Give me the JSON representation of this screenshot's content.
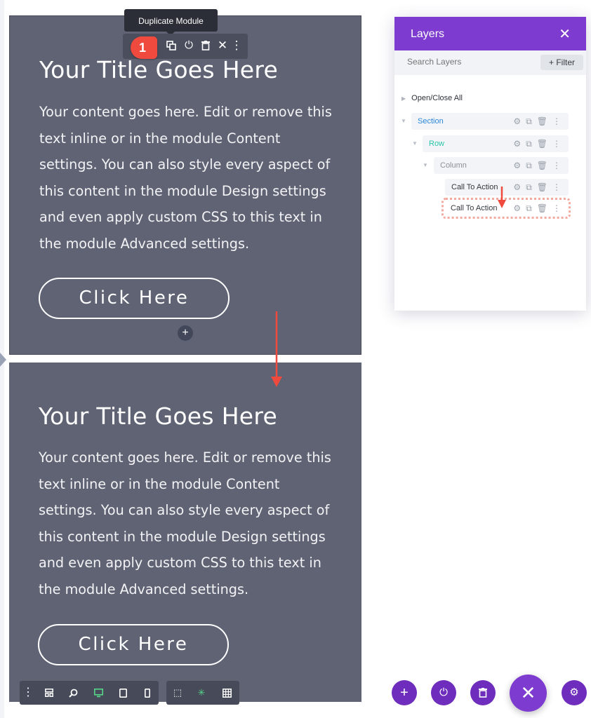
{
  "tooltip": "Duplicate Module",
  "step_badge": "1",
  "modules": [
    {
      "title": "Your Title Goes Here",
      "content": "Your content goes here. Edit or remove this text inline or in the module Content settings. You can also style every aspect of this content in the module Design settings and even apply custom CSS to this text in the module Advanced settings.",
      "button": "Click Here"
    },
    {
      "title": "Your Title Goes Here",
      "content": "Your content goes here. Edit or remove this text inline or in the module Content settings. You can also style every aspect of this content in the module Design settings and even apply custom CSS to this text in the module Advanced settings.",
      "button": "Click Here"
    }
  ],
  "module_toolbar": [
    "duplicate-icon",
    "power-icon",
    "trash-icon",
    "close-icon",
    "more-icon"
  ],
  "add_module_glyph": "+",
  "layers": {
    "title": "Layers",
    "close_glyph": "✕",
    "search_placeholder": "Search Layers",
    "filter_label": "+ Filter",
    "open_close_all": "Open/Close All",
    "tree": [
      {
        "label": "Section",
        "color": "#2b87da"
      },
      {
        "label": "Row",
        "color": "#29c4a9"
      },
      {
        "label": "Column",
        "color": "#8a8f99"
      },
      {
        "label": "Call To Action",
        "color": "#32373c"
      },
      {
        "label": "Call To Action",
        "color": "#32373c"
      }
    ]
  },
  "bottom_toolbar": {
    "left": [
      "more-icon",
      "wireframe-icon",
      "zoom-icon",
      "desktop-icon",
      "tablet-icon",
      "phone-icon"
    ],
    "active": "desktop-icon",
    "right": [
      "select-icon",
      "click-mode-icon",
      "grid-icon"
    ]
  },
  "fabs": [
    "add-icon",
    "power-icon",
    "trash-icon",
    "close-icon",
    "settings-icon"
  ],
  "colors": {
    "module_bg": "#5f6373",
    "accent_purple": "#7e3bd0",
    "annotation_red": "#ef4a3d",
    "active_green": "#55d48a"
  }
}
